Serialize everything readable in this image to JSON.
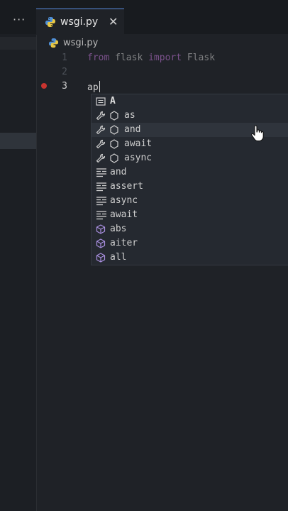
{
  "tab": {
    "label": "wsgi.py",
    "more": "···",
    "close": "✕"
  },
  "breadcrumb": {
    "file": "wsgi.py"
  },
  "editor": {
    "lines": [
      {
        "number": "1",
        "tokens": [
          "from",
          "flask",
          "import",
          "Flask"
        ]
      },
      {
        "number": "2"
      },
      {
        "number": "3",
        "typed": "ap"
      }
    ]
  },
  "suggestions": {
    "items": [
      {
        "label": "A",
        "icon": "text-list-icon"
      },
      {
        "label": "as",
        "icon": "wrench-module-icon"
      },
      {
        "label": "and",
        "icon": "wrench-module-icon"
      },
      {
        "label": "await",
        "icon": "wrench-module-icon"
      },
      {
        "label": "async",
        "icon": "wrench-module-icon"
      },
      {
        "label": "and",
        "icon": "keyword-lines-icon"
      },
      {
        "label": "assert",
        "icon": "keyword-lines-icon"
      },
      {
        "label": "async",
        "icon": "keyword-lines-icon"
      },
      {
        "label": "await",
        "icon": "keyword-lines-icon"
      },
      {
        "label": "abs",
        "icon": "cube-icon"
      },
      {
        "label": "aiter",
        "icon": "cube-icon"
      },
      {
        "label": "all",
        "icon": "cube-icon"
      }
    ]
  },
  "colors": {
    "keyword": "#c678dd",
    "breakpoint": "#c8342f",
    "tab_accent": "#5a8de0",
    "editor_bg": "#1f2227"
  }
}
